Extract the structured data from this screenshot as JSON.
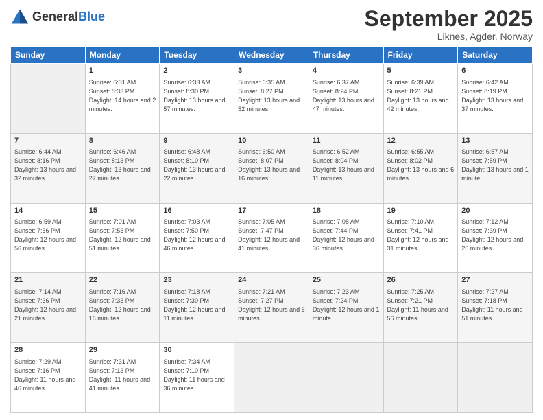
{
  "header": {
    "logo_general": "General",
    "logo_blue": "Blue",
    "month_title": "September 2025",
    "location": "Liknes, Agder, Norway"
  },
  "weekdays": [
    "Sunday",
    "Monday",
    "Tuesday",
    "Wednesday",
    "Thursday",
    "Friday",
    "Saturday"
  ],
  "weeks": [
    [
      {
        "day": "",
        "empty": true
      },
      {
        "day": "1",
        "sunrise": "Sunrise: 6:31 AM",
        "sunset": "Sunset: 8:33 PM",
        "daylight": "Daylight: 14 hours and 2 minutes."
      },
      {
        "day": "2",
        "sunrise": "Sunrise: 6:33 AM",
        "sunset": "Sunset: 8:30 PM",
        "daylight": "Daylight: 13 hours and 57 minutes."
      },
      {
        "day": "3",
        "sunrise": "Sunrise: 6:35 AM",
        "sunset": "Sunset: 8:27 PM",
        "daylight": "Daylight: 13 hours and 52 minutes."
      },
      {
        "day": "4",
        "sunrise": "Sunrise: 6:37 AM",
        "sunset": "Sunset: 8:24 PM",
        "daylight": "Daylight: 13 hours and 47 minutes."
      },
      {
        "day": "5",
        "sunrise": "Sunrise: 6:39 AM",
        "sunset": "Sunset: 8:21 PM",
        "daylight": "Daylight: 13 hours and 42 minutes."
      },
      {
        "day": "6",
        "sunrise": "Sunrise: 6:42 AM",
        "sunset": "Sunset: 8:19 PM",
        "daylight": "Daylight: 13 hours and 37 minutes."
      }
    ],
    [
      {
        "day": "7",
        "sunrise": "Sunrise: 6:44 AM",
        "sunset": "Sunset: 8:16 PM",
        "daylight": "Daylight: 13 hours and 32 minutes."
      },
      {
        "day": "8",
        "sunrise": "Sunrise: 6:46 AM",
        "sunset": "Sunset: 8:13 PM",
        "daylight": "Daylight: 13 hours and 27 minutes."
      },
      {
        "day": "9",
        "sunrise": "Sunrise: 6:48 AM",
        "sunset": "Sunset: 8:10 PM",
        "daylight": "Daylight: 13 hours and 22 minutes."
      },
      {
        "day": "10",
        "sunrise": "Sunrise: 6:50 AM",
        "sunset": "Sunset: 8:07 PM",
        "daylight": "Daylight: 13 hours and 16 minutes."
      },
      {
        "day": "11",
        "sunrise": "Sunrise: 6:52 AM",
        "sunset": "Sunset: 8:04 PM",
        "daylight": "Daylight: 13 hours and 11 minutes."
      },
      {
        "day": "12",
        "sunrise": "Sunrise: 6:55 AM",
        "sunset": "Sunset: 8:02 PM",
        "daylight": "Daylight: 13 hours and 6 minutes."
      },
      {
        "day": "13",
        "sunrise": "Sunrise: 6:57 AM",
        "sunset": "Sunset: 7:59 PM",
        "daylight": "Daylight: 13 hours and 1 minute."
      }
    ],
    [
      {
        "day": "14",
        "sunrise": "Sunrise: 6:59 AM",
        "sunset": "Sunset: 7:56 PM",
        "daylight": "Daylight: 12 hours and 56 minutes."
      },
      {
        "day": "15",
        "sunrise": "Sunrise: 7:01 AM",
        "sunset": "Sunset: 7:53 PM",
        "daylight": "Daylight: 12 hours and 51 minutes."
      },
      {
        "day": "16",
        "sunrise": "Sunrise: 7:03 AM",
        "sunset": "Sunset: 7:50 PM",
        "daylight": "Daylight: 12 hours and 46 minutes."
      },
      {
        "day": "17",
        "sunrise": "Sunrise: 7:05 AM",
        "sunset": "Sunset: 7:47 PM",
        "daylight": "Daylight: 12 hours and 41 minutes."
      },
      {
        "day": "18",
        "sunrise": "Sunrise: 7:08 AM",
        "sunset": "Sunset: 7:44 PM",
        "daylight": "Daylight: 12 hours and 36 minutes."
      },
      {
        "day": "19",
        "sunrise": "Sunrise: 7:10 AM",
        "sunset": "Sunset: 7:41 PM",
        "daylight": "Daylight: 12 hours and 31 minutes."
      },
      {
        "day": "20",
        "sunrise": "Sunrise: 7:12 AM",
        "sunset": "Sunset: 7:39 PM",
        "daylight": "Daylight: 12 hours and 26 minutes."
      }
    ],
    [
      {
        "day": "21",
        "sunrise": "Sunrise: 7:14 AM",
        "sunset": "Sunset: 7:36 PM",
        "daylight": "Daylight: 12 hours and 21 minutes."
      },
      {
        "day": "22",
        "sunrise": "Sunrise: 7:16 AM",
        "sunset": "Sunset: 7:33 PM",
        "daylight": "Daylight: 12 hours and 16 minutes."
      },
      {
        "day": "23",
        "sunrise": "Sunrise: 7:18 AM",
        "sunset": "Sunset: 7:30 PM",
        "daylight": "Daylight: 12 hours and 11 minutes."
      },
      {
        "day": "24",
        "sunrise": "Sunrise: 7:21 AM",
        "sunset": "Sunset: 7:27 PM",
        "daylight": "Daylight: 12 hours and 6 minutes."
      },
      {
        "day": "25",
        "sunrise": "Sunrise: 7:23 AM",
        "sunset": "Sunset: 7:24 PM",
        "daylight": "Daylight: 12 hours and 1 minute."
      },
      {
        "day": "26",
        "sunrise": "Sunrise: 7:25 AM",
        "sunset": "Sunset: 7:21 PM",
        "daylight": "Daylight: 11 hours and 56 minutes."
      },
      {
        "day": "27",
        "sunrise": "Sunrise: 7:27 AM",
        "sunset": "Sunset: 7:18 PM",
        "daylight": "Daylight: 11 hours and 51 minutes."
      }
    ],
    [
      {
        "day": "28",
        "sunrise": "Sunrise: 7:29 AM",
        "sunset": "Sunset: 7:16 PM",
        "daylight": "Daylight: 11 hours and 46 minutes."
      },
      {
        "day": "29",
        "sunrise": "Sunrise: 7:31 AM",
        "sunset": "Sunset: 7:13 PM",
        "daylight": "Daylight: 11 hours and 41 minutes."
      },
      {
        "day": "30",
        "sunrise": "Sunrise: 7:34 AM",
        "sunset": "Sunset: 7:10 PM",
        "daylight": "Daylight: 11 hours and 36 minutes."
      },
      {
        "day": "",
        "empty": true
      },
      {
        "day": "",
        "empty": true
      },
      {
        "day": "",
        "empty": true
      },
      {
        "day": "",
        "empty": true
      }
    ]
  ]
}
